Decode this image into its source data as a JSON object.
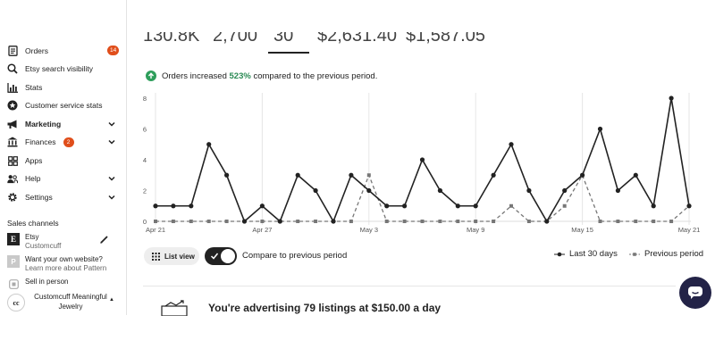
{
  "sidebar": {
    "items": [
      {
        "label": "Orders",
        "icon": "orders-icon",
        "badge": "14"
      },
      {
        "label": "Etsy search visibility",
        "icon": "search-icon"
      },
      {
        "label": "Stats",
        "icon": "bar-chart-icon"
      },
      {
        "label": "Customer service stats",
        "icon": "star-badge-icon"
      },
      {
        "label": "Marketing",
        "icon": "megaphone-icon"
      },
      {
        "label": "Finances",
        "icon": "bank-icon",
        "badge": "2"
      },
      {
        "label": "Apps",
        "icon": "apps-grid-icon"
      },
      {
        "label": "Help",
        "icon": "people-icon"
      },
      {
        "label": "Settings",
        "icon": "gear-icon"
      }
    ],
    "sales_channels_title": "Sales channels",
    "channels": [
      {
        "title": "Etsy",
        "subtitle": "Customcuff",
        "icon": "etsy-logo-icon"
      },
      {
        "title": "Want your own website?",
        "subtitle": "Learn more about Pattern",
        "icon": "pattern-logo-icon"
      },
      {
        "title": "Sell in person",
        "subtitle": "",
        "icon": "square-logo-icon"
      }
    ],
    "shop": {
      "avatar_text": "cc",
      "name": "Customcuff Meaningful Jewelry"
    }
  },
  "stats_strip": {
    "values": [
      "130.8K",
      "2,700",
      "30",
      "$2,631.40",
      "$1,587.05"
    ]
  },
  "orders_note": {
    "prefix": "Orders increased ",
    "percent": "523%",
    "suffix": " compared to the previous period."
  },
  "chart_data": {
    "type": "line",
    "title": "",
    "xlabel": "",
    "ylabel": "",
    "ylim": [
      0,
      8
    ],
    "yticks": [
      0,
      2,
      4,
      6,
      8
    ],
    "x_tick_labels": [
      "Apr 21",
      "Apr 27",
      "May 3",
      "May 9",
      "May 15",
      "May 21"
    ],
    "x_tick_index": [
      0,
      6,
      12,
      18,
      24,
      30
    ],
    "series": [
      {
        "name": "Last 30 days",
        "style": "solid",
        "color": "#222222",
        "values": [
          1,
          1,
          1,
          5,
          3,
          0,
          1,
          0,
          3,
          2,
          0,
          3,
          2,
          1,
          1,
          4,
          2,
          1,
          1,
          3,
          5,
          2,
          0,
          2,
          3,
          6,
          2,
          3,
          1,
          8,
          1
        ]
      },
      {
        "name": "Previous period",
        "style": "dashed",
        "color": "#777777",
        "values": [
          0,
          0,
          0,
          0,
          0,
          0,
          0,
          0,
          0,
          0,
          0,
          0,
          3,
          0,
          0,
          0,
          0,
          0,
          0,
          0,
          1,
          0,
          0,
          1,
          3,
          0,
          0,
          0,
          0,
          0,
          1
        ]
      }
    ],
    "grid": "vertical-at-ticks",
    "legend": "bottom-right"
  },
  "controls": {
    "list_view_label": "List view",
    "compare_label": "Compare to previous period",
    "compare_on": true
  },
  "advert": {
    "text": "You're advertising 79 listings at $150.00 a day"
  },
  "colors": {
    "accent_green": "#2e9e5b",
    "badge": "#e04e1b",
    "help_button": "#232347"
  }
}
